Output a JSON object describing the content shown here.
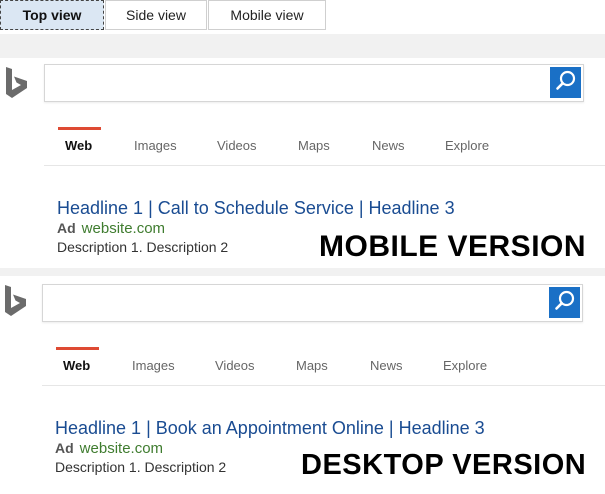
{
  "tabs": [
    {
      "label": "Top view",
      "active": true
    },
    {
      "label": "Side view",
      "active": false
    },
    {
      "label": "Mobile view",
      "active": false
    }
  ],
  "colors": {
    "accent": "#1a70c6",
    "nav_underline": "#de4a33",
    "headline": "#1a4c92",
    "url": "#3f7c2f",
    "logo": "#6b6b6b"
  },
  "mobile": {
    "logo_icon": "bing-logo-icon",
    "search_icon": "search-icon",
    "nav": [
      "Web",
      "Images",
      "Videos",
      "Maps",
      "News",
      "Explore"
    ],
    "active_nav": "Web",
    "headline": "Headline 1 | Call to Schedule Service | Headline 3",
    "ad_label": "Ad",
    "url": "website.com",
    "description": "Description 1. Description 2",
    "version_label": "MOBILE VERSION"
  },
  "desktop": {
    "logo_icon": "bing-logo-icon",
    "search_icon": "search-icon",
    "nav": [
      "Web",
      "Images",
      "Videos",
      "Maps",
      "News",
      "Explore"
    ],
    "active_nav": "Web",
    "headline": "Headline 1 | Book an Appointment Online | Headline 3",
    "ad_label": "Ad",
    "url": "website.com",
    "description": "Description 1. Description 2",
    "version_label": "DESKTOP VERSION"
  }
}
